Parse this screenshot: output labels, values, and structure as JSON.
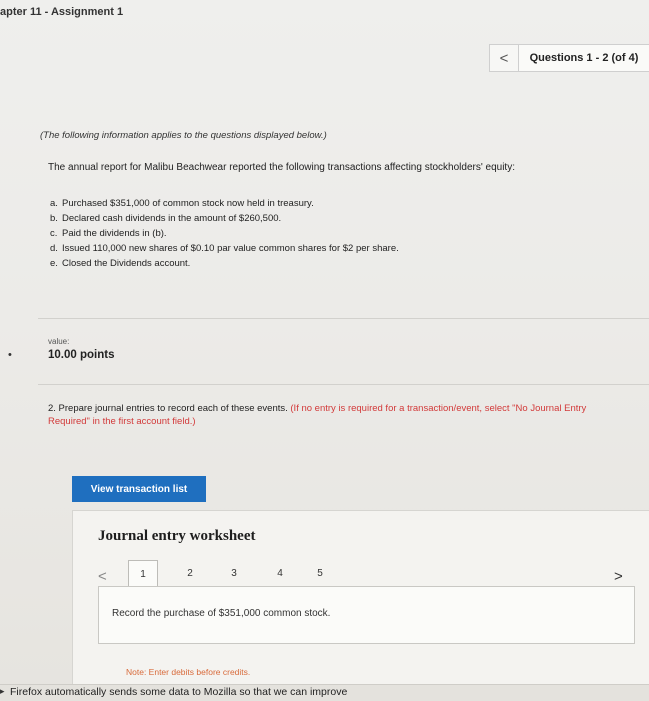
{
  "header": {
    "chapter_title": "apter 11 - Assignment 1"
  },
  "question_nav": {
    "prev_glyph": "<",
    "count_label": "Questions 1 - 2 (of 4)"
  },
  "problem": {
    "info_note": "(The following information applies to the questions displayed below.)",
    "intro": "The annual report for Malibu Beachwear reported the following transactions affecting stockholders' equity:",
    "transactions": [
      {
        "letter": "a.",
        "text": "Purchased $351,000 of common stock now held in treasury."
      },
      {
        "letter": "b.",
        "text": "Declared cash dividends in the amount of $260,500."
      },
      {
        "letter": "c.",
        "text": "Paid the dividends in (b)."
      },
      {
        "letter": "d.",
        "text": "Issued 110,000 new shares of $0.10 par value common shares for $2 per share."
      },
      {
        "letter": "e.",
        "text": "Closed the Dividends account."
      }
    ]
  },
  "value": {
    "label": "value:",
    "points": "10.00 points",
    "bullet": "•"
  },
  "question2": {
    "text": "2. Prepare journal entries to record each of these events.",
    "instruction": "(If no entry is required for a transaction/event, select \"No Journal Entry Required\" in the first account field.)"
  },
  "view_button": {
    "label": "View transaction list"
  },
  "worksheet": {
    "title": "Journal entry worksheet",
    "prev_glyph": "<",
    "next_glyph": ">",
    "steps": [
      "1",
      "2",
      "3",
      "4",
      "5"
    ],
    "record_text": "Record the purchase of $351,000 common stock.",
    "note": "Note: Enter debits before credits."
  },
  "firefox": {
    "text": "Firefox automatically sends some data to Mozilla so that we can improve"
  }
}
